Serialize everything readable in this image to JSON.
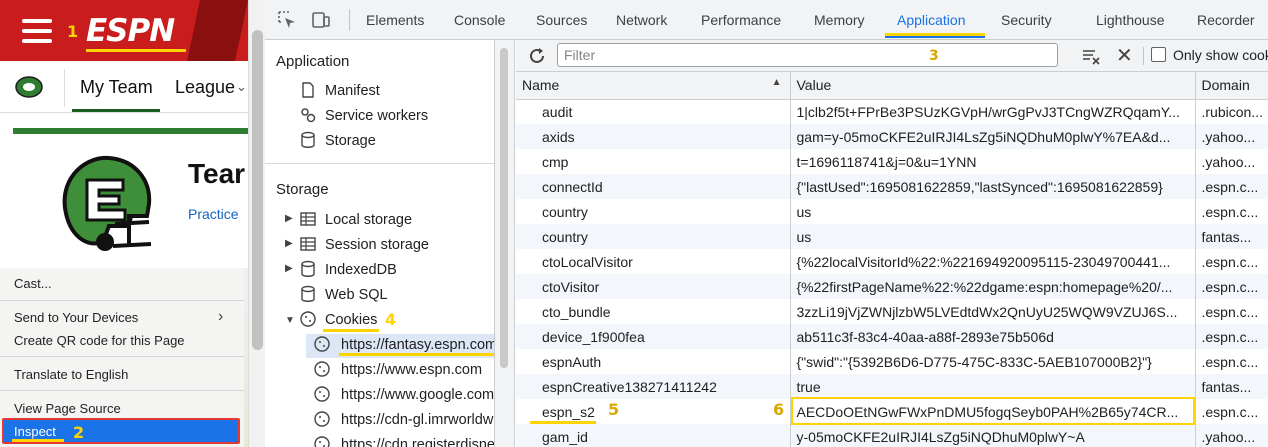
{
  "espn": {
    "logo": "ESPN",
    "nav": {
      "my_team": "My Team",
      "league": "League"
    },
    "team_title": "Tear",
    "practice": "Practice",
    "annotation_menu": "1",
    "annotation_inspect": "2"
  },
  "context_menu": {
    "items": [
      "Cast...",
      "Send to Your Devices",
      "Create QR code for this Page",
      "Translate to English",
      "View Page Source",
      "Inspect"
    ]
  },
  "devtools": {
    "tabs": [
      "Elements",
      "Console",
      "Sources",
      "Network",
      "Performance",
      "Memory",
      "Application",
      "Security",
      "Lighthouse",
      "Recorder"
    ],
    "active_tab": "Application",
    "annotation_tab": "3",
    "sidebar": {
      "application_header": "Application",
      "application_items": [
        "Manifest",
        "Service workers",
        "Storage"
      ],
      "storage_header": "Storage",
      "storage_items": [
        "Local storage",
        "Session storage",
        "IndexedDB",
        "Web SQL",
        "Cookies"
      ],
      "annotation_cookies": "4",
      "cookie_origins": [
        "https://fantasy.espn.com",
        "https://www.espn.com",
        "https://www.google.com",
        "https://cdn-gl.imrworldwide.com",
        "https://cdn.registerdisney.go.com"
      ]
    },
    "filter": {
      "placeholder": "Filter",
      "only_show": "Only show cookies with an issue"
    },
    "table": {
      "headers": {
        "name": "Name",
        "value": "Value",
        "domain": "Domain"
      },
      "rows": [
        {
          "name": "audit",
          "value": "1|clb2f5t+FPrBe3PSUzKGVpH/wrGgPvJ3TCngWZRQqamY...",
          "domain": ".rubicon..."
        },
        {
          "name": "axids",
          "value": "gam=y-05moCKFE2uIRJI4LsZg5iNQDhuM0plwY%7EA&d...",
          "domain": ".yahoo..."
        },
        {
          "name": "cmp",
          "value": "t=1696118741&j=0&u=1YNN",
          "domain": ".yahoo..."
        },
        {
          "name": "connectId",
          "value": "{\"lastUsed\":1695081622859,\"lastSynced\":1695081622859}",
          "domain": ".espn.c..."
        },
        {
          "name": "country",
          "value": "us",
          "domain": ".espn.c..."
        },
        {
          "name": "country",
          "value": "us",
          "domain": "fantas..."
        },
        {
          "name": "ctoLocalVisitor",
          "value": "{%22localVisitorId%22:%221694920095115-23049700441...",
          "domain": ".espn.c..."
        },
        {
          "name": "ctoVisitor",
          "value": "{%22firstPageName%22:%22dgame:espn:homepage%20/...",
          "domain": ".espn.c..."
        },
        {
          "name": "cto_bundle",
          "value": "3zzLi19jVjZWNjlzbW5LVEdtdWx2QnUyU25WQW9VZUJ6S...",
          "domain": ".espn.c..."
        },
        {
          "name": "device_1f900fea",
          "value": "ab511c3f-83c4-40aa-a88f-2893e75b506d",
          "domain": ".espn.c..."
        },
        {
          "name": "espnAuth",
          "value": "{\"swid\":\"{5392B6D6-D775-475C-833C-5AEB107000B2}\"}",
          "domain": ".espn.c..."
        },
        {
          "name": "espnCreative138271411242",
          "value": "true",
          "domain": "fantas..."
        },
        {
          "name": "espn_s2",
          "value": "AECDoOEtNGwFWxPnDMU5fogqSeyb0PAH%2B65y74CR...",
          "domain": ".espn.c..."
        },
        {
          "name": "gam_id",
          "value": "y-05moCKFE2uIRJI4LsZg5iNQDhuM0plwY~A",
          "domain": ".yahoo..."
        }
      ]
    },
    "annotation_name": "5",
    "annotation_value": "6"
  },
  "colors": {
    "espn_red": "#c91c1c",
    "accent_blue": "#1a73e8",
    "annotation_yellow": "#ffd400",
    "helmet_green": "#2e7d32"
  }
}
